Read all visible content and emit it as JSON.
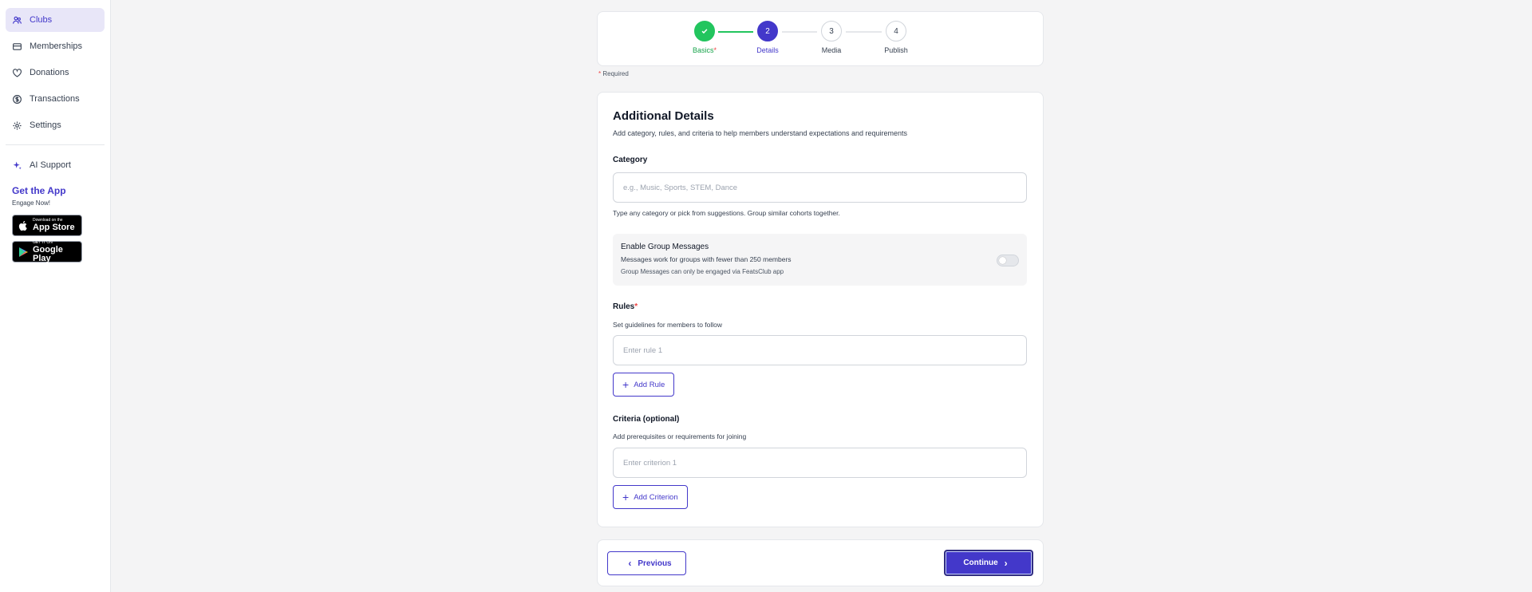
{
  "sidebar": {
    "items": [
      {
        "label": "Clubs",
        "icon": "clubs-icon",
        "active": true
      },
      {
        "label": "Memberships",
        "icon": "membership-card-icon"
      },
      {
        "label": "Donations",
        "icon": "heart-icon"
      },
      {
        "label": "Transactions",
        "icon": "dollar-icon"
      },
      {
        "label": "Settings",
        "icon": "gear-icon"
      }
    ],
    "ai_support": "AI Support",
    "get_app_title": "Get the App",
    "get_app_sub": "Engage Now!",
    "app_store": {
      "small": "Download on the",
      "big": "App Store"
    },
    "google_play": {
      "small": "GET IT ON",
      "big": "Google Play"
    }
  },
  "stepper": {
    "steps": [
      {
        "number": "",
        "label": "Basics",
        "state": "done",
        "required_mark": "*"
      },
      {
        "number": "2",
        "label": "Details",
        "state": "current"
      },
      {
        "number": "3",
        "label": "Media",
        "state": "upcoming"
      },
      {
        "number": "4",
        "label": "Publish",
        "state": "upcoming"
      }
    ]
  },
  "required_note": {
    "star": "*",
    "text": " Required"
  },
  "details": {
    "title": "Additional Details",
    "subtitle": "Add category, rules, and criteria to help members understand expectations and requirements",
    "category": {
      "label": "Category",
      "placeholder": "e.g., Music, Sports, STEM, Dance",
      "value": "",
      "helper": "Type any category or pick from suggestions. Group similar cohorts together."
    },
    "group_messages": {
      "title": "Enable Group Messages",
      "description": "Messages work for groups with fewer than 250 members",
      "note": "Group Messages can only be engaged via FeatsClub app",
      "enabled": false
    },
    "rules": {
      "label": "Rules",
      "required_mark": "*",
      "helper": "Set guidelines for members to follow",
      "placeholder": "Enter rule 1",
      "add_label": "Add Rule"
    },
    "criteria": {
      "label": "Criteria (optional)",
      "helper": "Add prerequisites or requirements for joining",
      "placeholder": "Enter criterion 1",
      "add_label": "Add Criterion"
    }
  },
  "footer": {
    "previous_label": "Previous",
    "continue_label": "Continue"
  },
  "colors": {
    "accent": "#4338ca",
    "success": "#22c55e",
    "required": "#ef4444"
  }
}
